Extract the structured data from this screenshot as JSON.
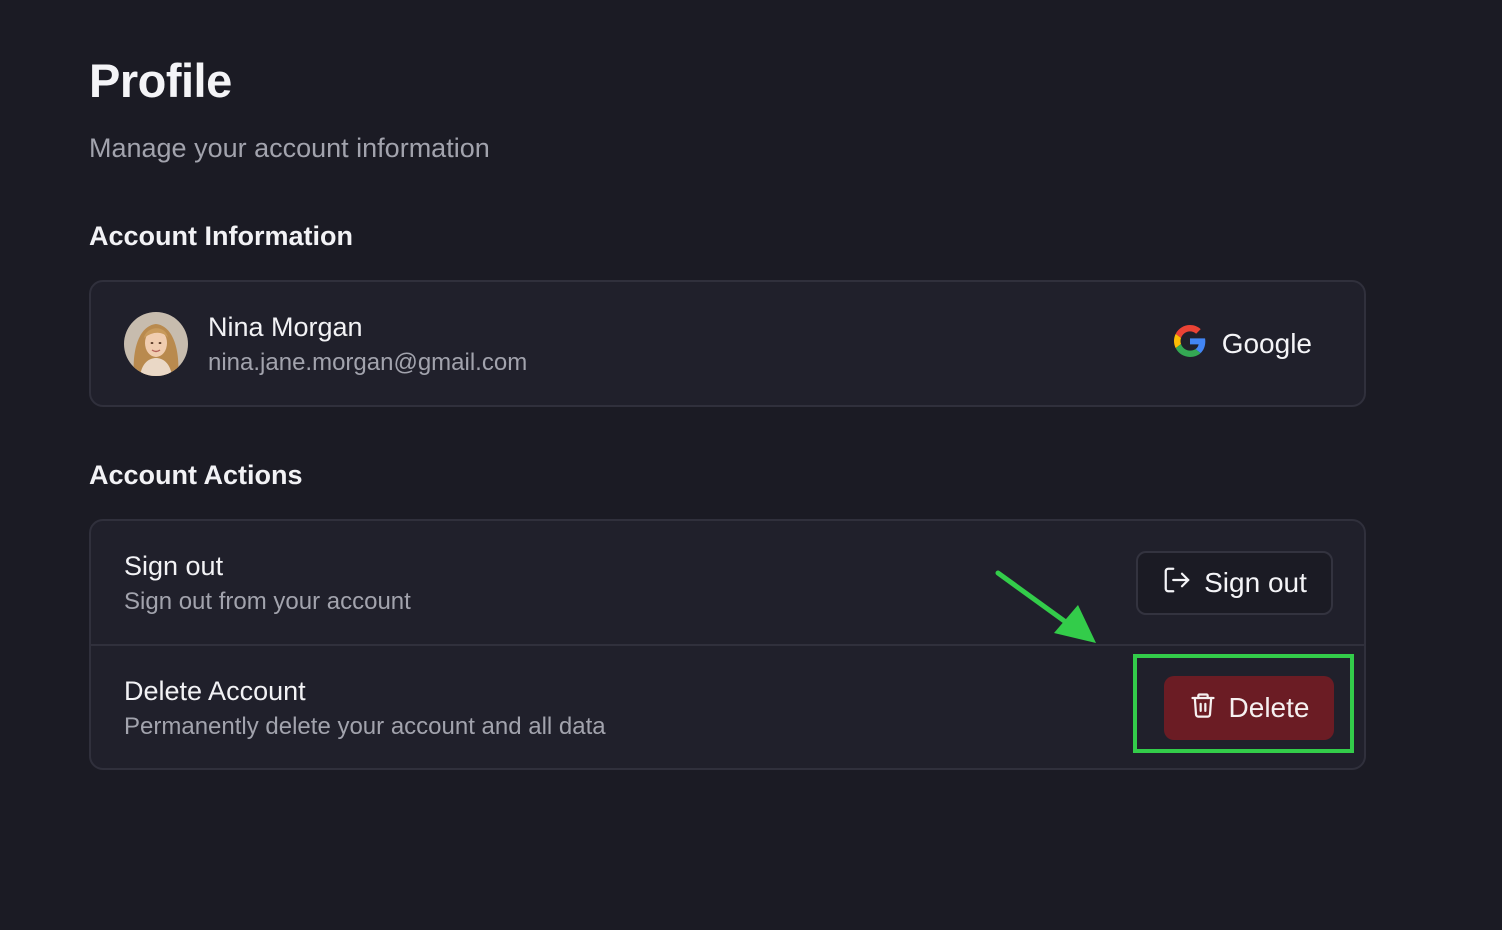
{
  "header": {
    "title": "Profile",
    "subtitle": "Manage your account information"
  },
  "account_information": {
    "heading": "Account Information",
    "user": {
      "name": "Nina Morgan",
      "email": "nina.jane.morgan@gmail.com"
    },
    "provider": {
      "label": "Google",
      "icon": "google-icon"
    }
  },
  "account_actions": {
    "heading": "Account Actions",
    "sign_out": {
      "title": "Sign out",
      "description": "Sign out from your account",
      "button_label": "Sign out",
      "button_icon": "sign-out-icon"
    },
    "delete_account": {
      "title": "Delete Account",
      "description": "Permanently delete your account and all data",
      "button_label": "Delete",
      "button_icon": "trash-icon"
    }
  },
  "annotation": {
    "highlight_color": "#33cc4a",
    "arrow_color": "#33cc4a"
  },
  "colors": {
    "background": "#1b1b24",
    "card": "#20202b",
    "border": "#30303c",
    "danger": "#6b1c24"
  }
}
